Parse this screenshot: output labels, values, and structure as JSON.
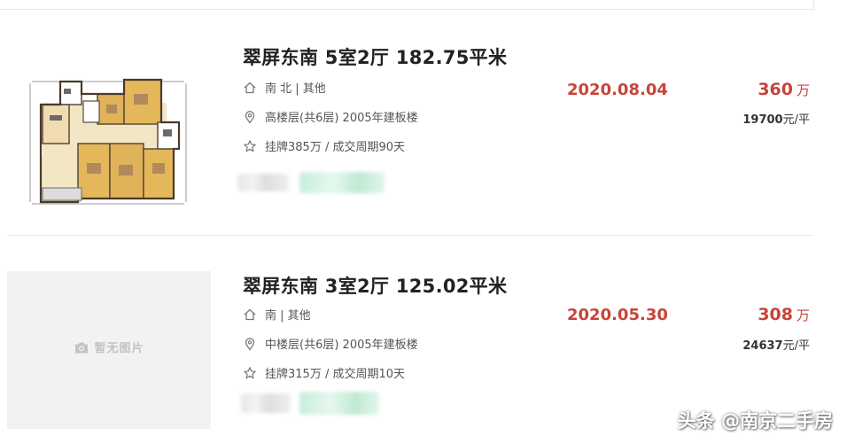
{
  "listings": [
    {
      "title": "翠屏东南 5室2厅 182.75平米",
      "orientation": "南 北 | 其他",
      "floor_info": "高楼层(共6层) 2005年建板楼",
      "listing_info": "挂牌385万 / 成交周期90天",
      "deal_date": "2020.08.04",
      "total_price": "360",
      "price_unit": "万",
      "unit_price": "19700",
      "unit_price_suffix": "元/平",
      "has_floorplan": true
    },
    {
      "title": "翠屏东南 3室2厅 125.02平米",
      "orientation": "南 | 其他",
      "floor_info": "中楼层(共6层) 2005年建板楼",
      "listing_info": "挂牌315万 / 成交周期10天",
      "deal_date": "2020.05.30",
      "total_price": "308",
      "price_unit": "万",
      "unit_price": "24637",
      "unit_price_suffix": "元/平",
      "placeholder_text": "暂无图片",
      "has_floorplan": false
    }
  ],
  "watermark": "头条 @南京二手房",
  "icons": {
    "orientation": "home-icon",
    "floor": "location-pin-icon",
    "listing": "star-icon",
    "placeholder": "camera-icon"
  },
  "colors": {
    "accent": "#c8443a",
    "title": "#222222",
    "text": "#555555",
    "divider": "#ececec",
    "placeholder_bg": "#f2f2f2",
    "floorplan_room": "#e4b85a",
    "floorplan_wall": "#5a4a3a"
  }
}
